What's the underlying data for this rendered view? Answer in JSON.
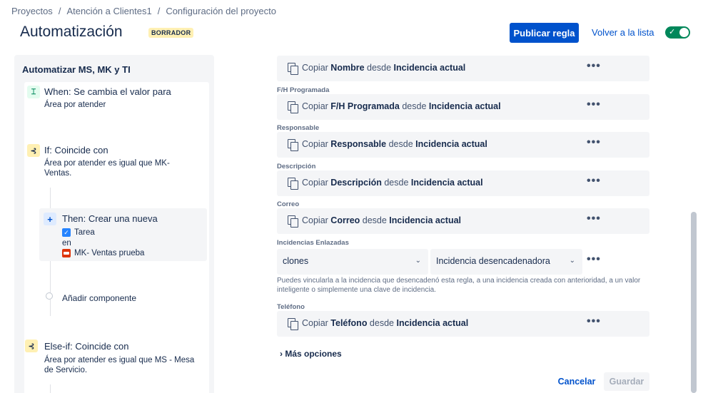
{
  "breadcrumb": [
    "Proyectos",
    "Atención a Clientes1",
    "Configuración del proyecto"
  ],
  "header": {
    "title": "Automatización",
    "badge": "BORRADOR",
    "publish_label": "Publicar regla",
    "back_label": "Volver a la lista",
    "toggle_on": true
  },
  "rule": {
    "name": "Automatizar MS,  MK y TI",
    "when": {
      "title": "When: Se cambia el valor para",
      "desc": "Área por atender"
    },
    "if": {
      "title": "If: Coincide con",
      "desc_line1": "Área por atender es igual que MK-",
      "desc_line2": "Ventas."
    },
    "then": {
      "title": "Then: Crear una nueva",
      "issue_type": "Tarea",
      "connector": "en",
      "project": "MK- Ventas prueba"
    },
    "add_component": "Añadir componente",
    "elseif": {
      "title": "Else-if: Coincide con",
      "desc_line1": "Área por atender es igual que MS - Mesa",
      "desc_line2": "de Servicio."
    }
  },
  "fields": [
    {
      "label": "",
      "prefix": "Copiar ",
      "field": "Nombre",
      "mid": " desde ",
      "source": "Incidencia actual"
    },
    {
      "label": "F/H Programada",
      "prefix": "Copiar ",
      "field": "F/H Programada",
      "mid": " desde ",
      "source": "Incidencia actual"
    },
    {
      "label": "Responsable",
      "prefix": "Copiar ",
      "field": "Responsable",
      "mid": " desde ",
      "source": "Incidencia actual"
    },
    {
      "label": "Descripción",
      "prefix": "Copiar ",
      "field": "Descripción",
      "mid": " desde ",
      "source": "Incidencia actual"
    },
    {
      "label": "Correo",
      "prefix": "Copiar ",
      "field": "Correo",
      "mid": " desde ",
      "source": "Incidencia actual"
    }
  ],
  "linked": {
    "label": "Incidencias Enlazadas",
    "link_type": "clones",
    "target": "Incidencia desencadenadora",
    "help": "Puedes vincularla a la incidencia que desencadenó esta regla, a una incidencia creada con anterioridad, a un valor inteligente o simplemente una clave de incidencia."
  },
  "phone": {
    "label": "Teléfono",
    "prefix": "Copiar ",
    "field": "Teléfono",
    "mid": " desde ",
    "source": "Incidencia actual"
  },
  "more_options": "Más opciones",
  "footer": {
    "cancel": "Cancelar",
    "save": "Guardar"
  },
  "dots": "•••"
}
